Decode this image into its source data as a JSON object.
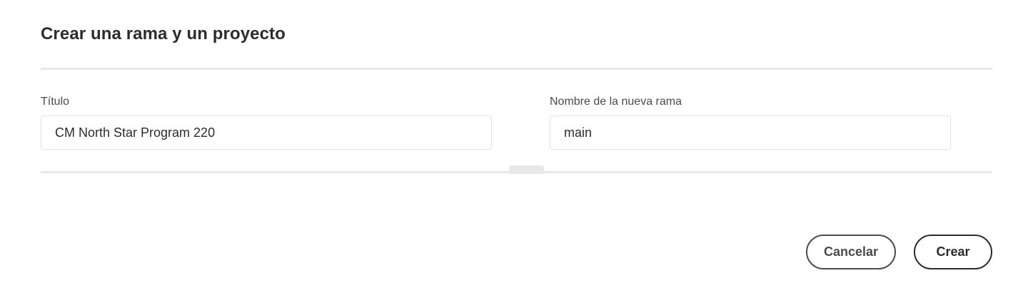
{
  "dialog": {
    "title": "Crear una rama y un proyecto"
  },
  "form": {
    "title_field": {
      "label": "Título",
      "value": "CM North Star Program 220"
    },
    "branch_field": {
      "label": "Nombre de la nueva rama",
      "value": "main"
    }
  },
  "actions": {
    "cancel_label": "Cancelar",
    "create_label": "Crear"
  }
}
